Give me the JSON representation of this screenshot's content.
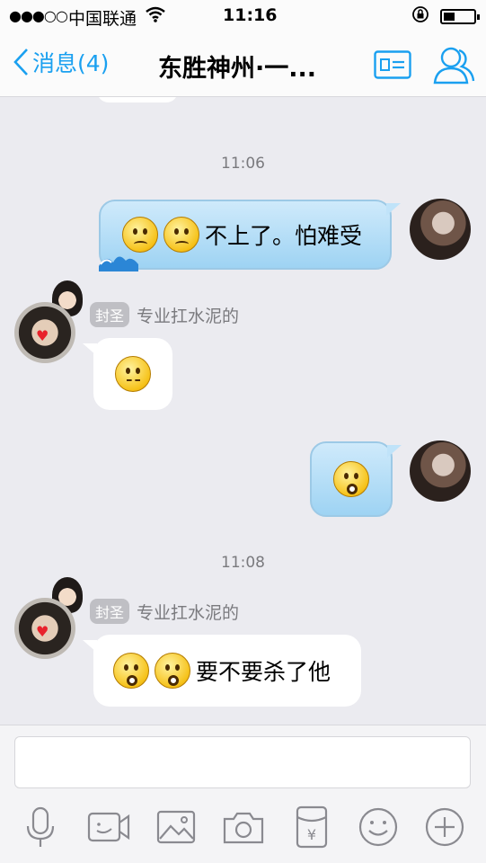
{
  "status_bar": {
    "signal": "●●●○○",
    "carrier": "中国联通",
    "time": "11:16"
  },
  "nav": {
    "back_label": "消息(4)",
    "title": "东胜神州·一...",
    "accent_color": "#1aa0f0"
  },
  "messages": [
    {
      "type": "timestamp",
      "text": "11:06"
    },
    {
      "type": "outgoing",
      "emojis": [
        "sad",
        "sad"
      ],
      "text": "不上了。怕难受"
    },
    {
      "type": "incoming",
      "tag": "封圣",
      "nickname": "专业扛水泥的",
      "emojis": [
        "wavy"
      ],
      "text": ""
    },
    {
      "type": "outgoing",
      "emojis": [
        "cry"
      ],
      "text": ""
    },
    {
      "type": "timestamp",
      "text": "11:08"
    },
    {
      "type": "incoming",
      "tag": "封圣",
      "nickname": "专业扛水泥的",
      "emojis": [
        "wow",
        "wow"
      ],
      "text": "要不要杀了他"
    }
  ],
  "input": {
    "placeholder": ""
  },
  "toolbar": {
    "icons": [
      "microphone-icon",
      "video-icon",
      "image-icon",
      "camera-icon",
      "red-packet-icon",
      "emoji-icon",
      "plus-icon"
    ]
  }
}
